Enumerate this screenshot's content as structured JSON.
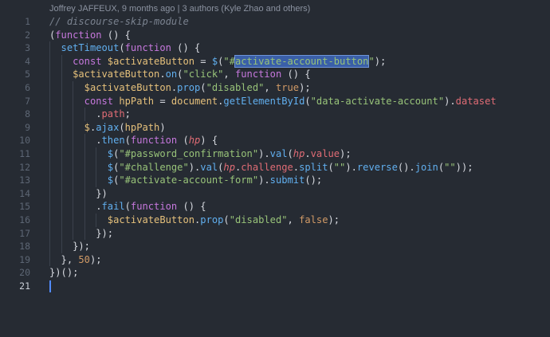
{
  "blame": {
    "text": "Joffrey JAFFEUX, 9 months ago | 3 authors (Kyle Zhao and others)"
  },
  "editor": {
    "active_line": 21,
    "lines": [
      {
        "n": "1",
        "indent": 0,
        "tokens": [
          {
            "t": "// discourse-skip-module",
            "c": "comment"
          }
        ]
      },
      {
        "n": "2",
        "indent": 0,
        "tokens": [
          {
            "t": "(",
            "c": "punct"
          },
          {
            "t": "function",
            "c": "keyword"
          },
          {
            "t": " () {",
            "c": "punct"
          }
        ]
      },
      {
        "n": "3",
        "indent": 1,
        "tokens": [
          {
            "t": "setTimeout",
            "c": "func"
          },
          {
            "t": "(",
            "c": "punct"
          },
          {
            "t": "function",
            "c": "keyword"
          },
          {
            "t": " () {",
            "c": "punct"
          }
        ]
      },
      {
        "n": "4",
        "indent": 2,
        "tokens": [
          {
            "t": "const",
            "c": "keyword"
          },
          {
            "t": " ",
            "c": "punct"
          },
          {
            "t": "$activateButton",
            "c": "var"
          },
          {
            "t": " = ",
            "c": "punct"
          },
          {
            "t": "$",
            "c": "func"
          },
          {
            "t": "(",
            "c": "punct"
          },
          {
            "t": "\"#",
            "c": "string"
          },
          {
            "t": "activate-account-button",
            "c": "string",
            "sel": true
          },
          {
            "t": "\"",
            "c": "string"
          },
          {
            "t": ");",
            "c": "punct"
          }
        ]
      },
      {
        "n": "5",
        "indent": 2,
        "tokens": [
          {
            "t": "$activateButton",
            "c": "var"
          },
          {
            "t": ".",
            "c": "punct"
          },
          {
            "t": "on",
            "c": "func"
          },
          {
            "t": "(",
            "c": "punct"
          },
          {
            "t": "\"click\"",
            "c": "string"
          },
          {
            "t": ", ",
            "c": "punct"
          },
          {
            "t": "function",
            "c": "keyword"
          },
          {
            "t": " () {",
            "c": "punct"
          }
        ]
      },
      {
        "n": "6",
        "indent": 3,
        "tokens": [
          {
            "t": "$activateButton",
            "c": "var"
          },
          {
            "t": ".",
            "c": "punct"
          },
          {
            "t": "prop",
            "c": "func"
          },
          {
            "t": "(",
            "c": "punct"
          },
          {
            "t": "\"disabled\"",
            "c": "string"
          },
          {
            "t": ", ",
            "c": "punct"
          },
          {
            "t": "true",
            "c": "number"
          },
          {
            "t": ");",
            "c": "punct"
          }
        ]
      },
      {
        "n": "7",
        "indent": 3,
        "tokens": [
          {
            "t": "const",
            "c": "keyword"
          },
          {
            "t": " ",
            "c": "punct"
          },
          {
            "t": "hpPath",
            "c": "var"
          },
          {
            "t": " = ",
            "c": "punct"
          },
          {
            "t": "document",
            "c": "var"
          },
          {
            "t": ".",
            "c": "punct"
          },
          {
            "t": "getElementById",
            "c": "func"
          },
          {
            "t": "(",
            "c": "punct"
          },
          {
            "t": "\"data-activate-account\"",
            "c": "string"
          },
          {
            "t": ").",
            "c": "punct"
          },
          {
            "t": "dataset",
            "c": "prop"
          }
        ]
      },
      {
        "n": "8",
        "indent": 4,
        "tokens": [
          {
            "t": ".",
            "c": "punct"
          },
          {
            "t": "path",
            "c": "prop"
          },
          {
            "t": ";",
            "c": "punct"
          }
        ]
      },
      {
        "n": "9",
        "indent": 3,
        "tokens": [
          {
            "t": "$",
            "c": "var"
          },
          {
            "t": ".",
            "c": "punct"
          },
          {
            "t": "ajax",
            "c": "func"
          },
          {
            "t": "(",
            "c": "punct"
          },
          {
            "t": "hpPath",
            "c": "var"
          },
          {
            "t": ")",
            "c": "punct"
          }
        ]
      },
      {
        "n": "10",
        "indent": 4,
        "tokens": [
          {
            "t": ".",
            "c": "punct"
          },
          {
            "t": "then",
            "c": "func"
          },
          {
            "t": "(",
            "c": "punct"
          },
          {
            "t": "function",
            "c": "keyword"
          },
          {
            "t": " (",
            "c": "punct"
          },
          {
            "t": "hp",
            "c": "param"
          },
          {
            "t": ") {",
            "c": "punct"
          }
        ]
      },
      {
        "n": "11",
        "indent": 5,
        "tokens": [
          {
            "t": "$",
            "c": "func"
          },
          {
            "t": "(",
            "c": "punct"
          },
          {
            "t": "\"#password_confirmation\"",
            "c": "string"
          },
          {
            "t": ").",
            "c": "punct"
          },
          {
            "t": "val",
            "c": "func"
          },
          {
            "t": "(",
            "c": "punct"
          },
          {
            "t": "hp",
            "c": "param"
          },
          {
            "t": ".",
            "c": "punct"
          },
          {
            "t": "value",
            "c": "prop"
          },
          {
            "t": ");",
            "c": "punct"
          }
        ]
      },
      {
        "n": "12",
        "indent": 5,
        "tokens": [
          {
            "t": "$",
            "c": "func"
          },
          {
            "t": "(",
            "c": "punct"
          },
          {
            "t": "\"#challenge\"",
            "c": "string"
          },
          {
            "t": ").",
            "c": "punct"
          },
          {
            "t": "val",
            "c": "func"
          },
          {
            "t": "(",
            "c": "punct"
          },
          {
            "t": "hp",
            "c": "param"
          },
          {
            "t": ".",
            "c": "punct"
          },
          {
            "t": "challenge",
            "c": "prop"
          },
          {
            "t": ".",
            "c": "punct"
          },
          {
            "t": "split",
            "c": "func"
          },
          {
            "t": "(",
            "c": "punct"
          },
          {
            "t": "\"\"",
            "c": "string"
          },
          {
            "t": ").",
            "c": "punct"
          },
          {
            "t": "reverse",
            "c": "func"
          },
          {
            "t": "().",
            "c": "punct"
          },
          {
            "t": "join",
            "c": "func"
          },
          {
            "t": "(",
            "c": "punct"
          },
          {
            "t": "\"\"",
            "c": "string"
          },
          {
            "t": "));",
            "c": "punct"
          }
        ]
      },
      {
        "n": "13",
        "indent": 5,
        "tokens": [
          {
            "t": "$",
            "c": "func"
          },
          {
            "t": "(",
            "c": "punct"
          },
          {
            "t": "\"#activate-account-form\"",
            "c": "string"
          },
          {
            "t": ").",
            "c": "punct"
          },
          {
            "t": "submit",
            "c": "func"
          },
          {
            "t": "();",
            "c": "punct"
          }
        ]
      },
      {
        "n": "14",
        "indent": 4,
        "tokens": [
          {
            "t": "})",
            "c": "punct"
          }
        ]
      },
      {
        "n": "15",
        "indent": 4,
        "tokens": [
          {
            "t": ".",
            "c": "punct"
          },
          {
            "t": "fail",
            "c": "func"
          },
          {
            "t": "(",
            "c": "punct"
          },
          {
            "t": "function",
            "c": "keyword"
          },
          {
            "t": " () {",
            "c": "punct"
          }
        ]
      },
      {
        "n": "16",
        "indent": 5,
        "tokens": [
          {
            "t": "$activateButton",
            "c": "var"
          },
          {
            "t": ".",
            "c": "punct"
          },
          {
            "t": "prop",
            "c": "func"
          },
          {
            "t": "(",
            "c": "punct"
          },
          {
            "t": "\"disabled\"",
            "c": "string"
          },
          {
            "t": ", ",
            "c": "punct"
          },
          {
            "t": "false",
            "c": "number"
          },
          {
            "t": ");",
            "c": "punct"
          }
        ]
      },
      {
        "n": "17",
        "indent": 4,
        "tokens": [
          {
            "t": "});",
            "c": "punct"
          }
        ]
      },
      {
        "n": "18",
        "indent": 2,
        "tokens": [
          {
            "t": "});",
            "c": "punct"
          }
        ]
      },
      {
        "n": "19",
        "indent": 1,
        "tokens": [
          {
            "t": "}, ",
            "c": "punct"
          },
          {
            "t": "50",
            "c": "number"
          },
          {
            "t": ");",
            "c": "punct"
          }
        ]
      },
      {
        "n": "20",
        "indent": 0,
        "tokens": [
          {
            "t": "})();",
            "c": "punct"
          }
        ]
      },
      {
        "n": "21",
        "indent": 0,
        "tokens": []
      }
    ]
  }
}
